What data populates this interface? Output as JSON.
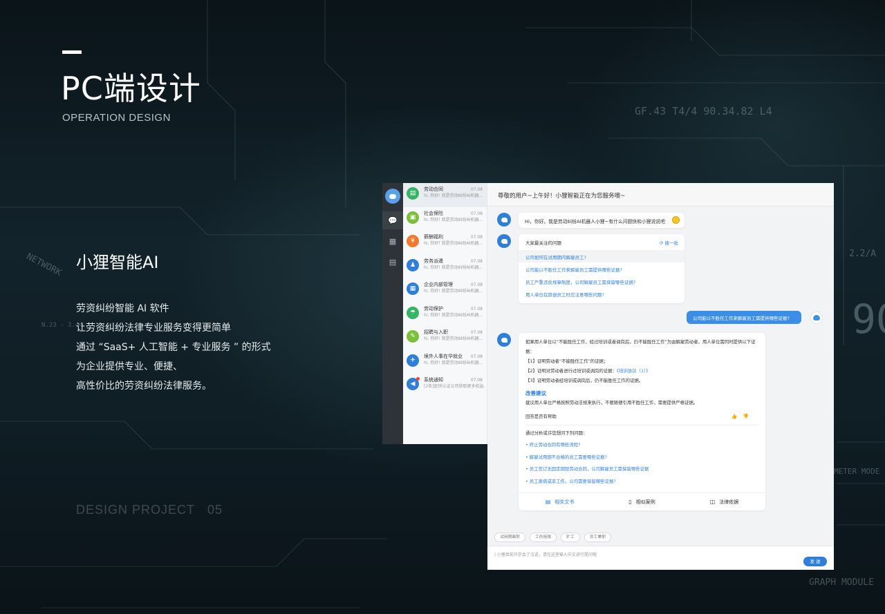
{
  "header": {
    "title": "PC端设计",
    "subtitle": "OPERATION DESIGN"
  },
  "product": {
    "name": "小狸智能AI",
    "intro": [
      "劳资纠纷智能 AI 软件",
      "让劳资纠纷法律专业服务变得更简单",
      "通过 “SaaS+ 人工智能 + 专业服务 ” 的形式",
      "为企业提供专业、便捷、",
      "高性价比的劳资纠纷法律服务。"
    ]
  },
  "footer": {
    "label": "DESIGN PROJECT",
    "number": "05"
  },
  "background_text": {
    "t1": "GF.43   T4/4   90.34.82   L4",
    "t2": "NETWORK",
    "t3": "N.23 - 3.44",
    "t4": "GRAPH MODULE",
    "t5": "METER MODE",
    "t6": "90",
    "t7": "2.2/A"
  },
  "conversations": [
    {
      "title": "劳动合同",
      "date": "07.08",
      "preview": "hi, 你好! 我是劳动纠纷AI机器...",
      "color": "#35b465",
      "icon": "contract-icon",
      "glyph": "▤"
    },
    {
      "title": "社会保险",
      "date": "07.08",
      "preview": "hi, 你好! 我是劳动纠纷AI机器...",
      "color": "#7cbf3a",
      "icon": "insurance-icon",
      "glyph": "▣"
    },
    {
      "title": "薪酬福利",
      "date": "07.08",
      "preview": "hi, 你好! 我是劳动纠纷AI机器...",
      "color": "#f07b2e",
      "icon": "salary-icon",
      "glyph": "¥"
    },
    {
      "title": "劳务派遣",
      "date": "07.08",
      "preview": "hi, 你好! 我是劳动纠纷AI机器...",
      "color": "#2f7fd8",
      "icon": "dispatch-icon",
      "glyph": "♟"
    },
    {
      "title": "企业内部管理",
      "date": "07.08",
      "preview": "hi, 你好! 我是劳动纠纷AI机器...",
      "color": "#2f7fd8",
      "icon": "management-icon",
      "glyph": "▦"
    },
    {
      "title": "劳动保护",
      "date": "07.08",
      "preview": "hi, 你好! 我是劳动纠纷AI机器...",
      "color": "#35b465",
      "icon": "protection-icon",
      "glyph": "☂"
    },
    {
      "title": "招聘与入职",
      "date": "07.08",
      "preview": "hi, 你好! 我是劳动纠纷AI机器...",
      "color": "#7cbf3a",
      "icon": "recruit-icon",
      "glyph": "✎"
    },
    {
      "title": "境外人事在华就业",
      "date": "07.08",
      "preview": "hi, 你好! 我是劳动纠纷AI机器...",
      "color": "#2f7fd8",
      "icon": "overseas-icon",
      "glyph": "✈"
    },
    {
      "title": "系统通知",
      "date": "07.08",
      "preview": "[2条]赶快认证公司获取更多权益...",
      "color": "#2f7fd8",
      "icon": "notification-icon",
      "glyph": "◀"
    }
  ],
  "chat": {
    "header": "尊敬的用户~上午好！小狸智能正在为您服务噢~",
    "greeting": "Hi，你好。我是劳动纠纷AI机器人小狸~有什么问题快和小狸说说吧",
    "faq": {
      "title": "大家最关注的问题",
      "refresh": "换一批",
      "items": [
        "公司如何在试用期内解雇员工?",
        "公司能以不胜任工作来解雇员工需提供哪些证据?",
        "员工严重违反规章制度，公司解雇员工需保留哪些证据?",
        "用人单位在辞退员工时应注意哪些问题?"
      ]
    },
    "user_message": "公司能以不胜任工作来解雇员工需提供哪些证据?",
    "answer": {
      "intro": "如果用人单位以“不能胜任工作，经过培训或者调岗后，仍不能胜任工作”为由解雇劳动者，用人单位需同时提供以下证据：",
      "e1": "【1】证明劳动者“不能胜任工作”的证据；",
      "e2": "【2】证明对劳动者进行过培训或调岗的证据：",
      "e2_link": "《培训协议（1）》",
      "e3": "【3】证明劳动者经培训或调岗后，仍不能胜任工作的证据。",
      "advice_title": "改善建议",
      "advice": "建议用人单位严格按照劳动法规来执行，不要随便引用不胜任工作，需要提供严格证据。",
      "helpful": "回答是否有帮助",
      "related_head": "通过分析或许您想问下列问题：",
      "related": [
        "• 终止劳动合同有哪些流程?",
        "• 解雇试用期不合格的员工需要哪些证据?",
        "• 员工签订无固定期限劳动合同，公司解雇员工需保留哪些证据",
        "• 员工患病或非工伤，公司需要保留哪些证据?"
      ],
      "tabs": [
        "相关文书",
        "相似案例",
        "法律依据"
      ]
    },
    "chips": [
      "试用期离职",
      "工伤赔偿",
      "旷工",
      "员工兼职"
    ],
    "input_placeholder": "| 小狸目前只学会了汉语，请在这里输入中文进行提问哦",
    "send_label": "发 送"
  },
  "colors": {
    "accent": "#2f7fd8",
    "user_bubble": "#3a8ee6",
    "rail": "#2d3338"
  }
}
